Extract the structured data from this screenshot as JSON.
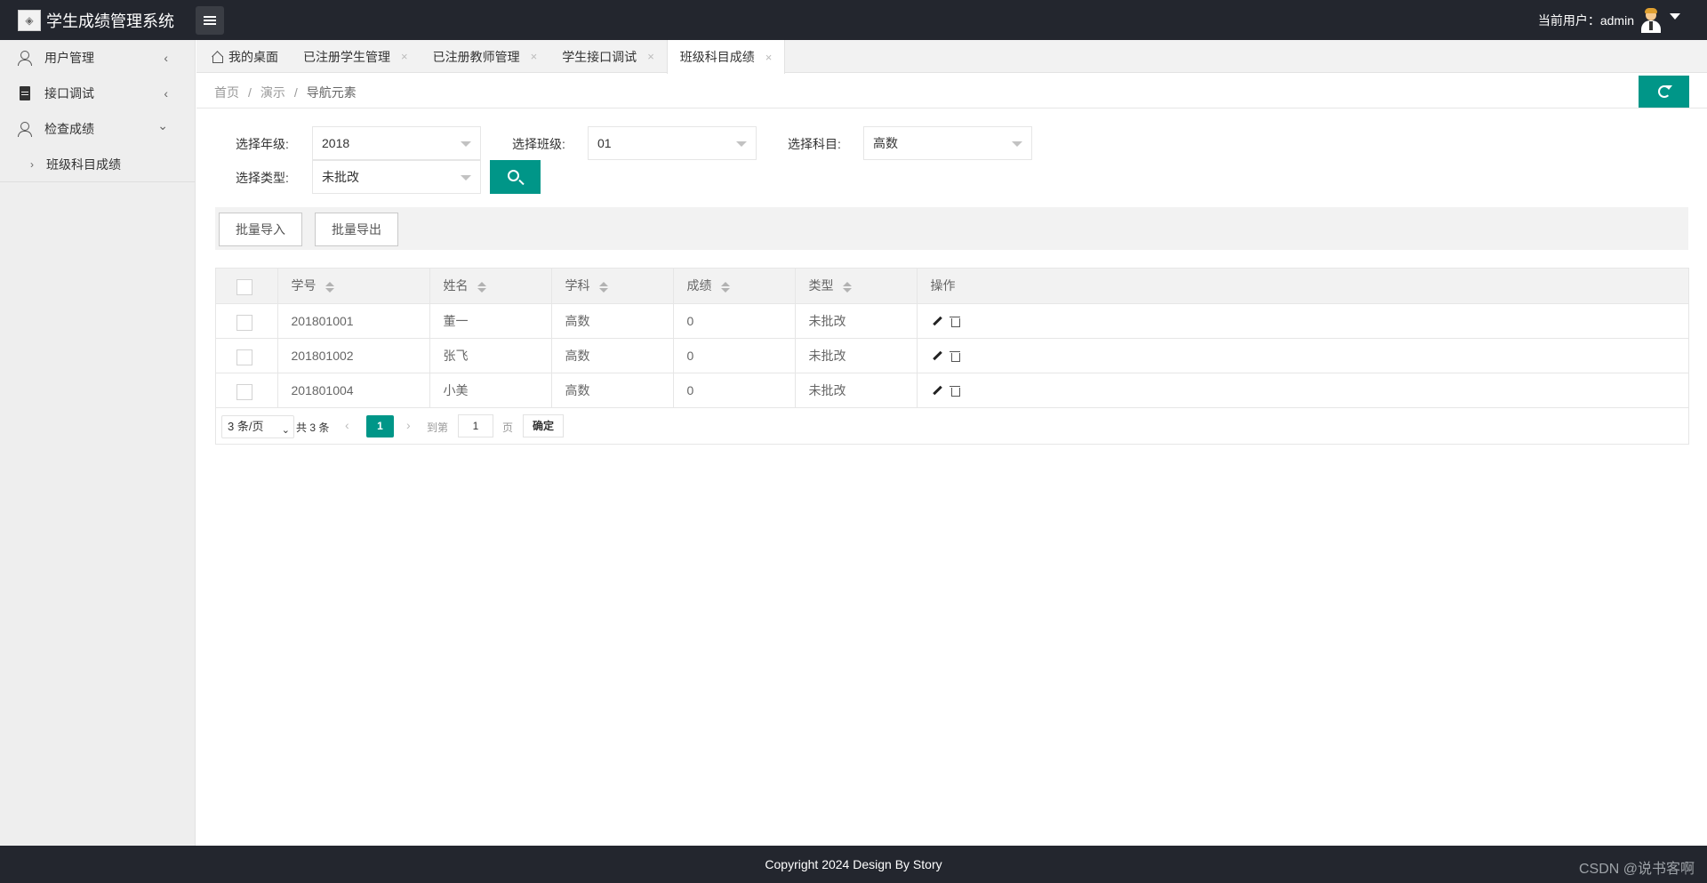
{
  "header": {
    "app_title": "学生成绩管理系统",
    "user_label": "当前用户：admin"
  },
  "sidebar": {
    "items": [
      {
        "label": "用户管理",
        "icon": "user-icon",
        "chevron": "‹"
      },
      {
        "label": "接口调试",
        "icon": "document-icon",
        "chevron": "‹"
      },
      {
        "label": "检查成绩",
        "icon": "user-icon",
        "chevron": "⌄"
      }
    ],
    "subitems": [
      {
        "label": "班级科目成绩",
        "arrow": "›"
      }
    ]
  },
  "tabs": [
    {
      "label": "我的桌面",
      "closable": false
    },
    {
      "label": "已注册学生管理",
      "closable": true,
      "close": "×"
    },
    {
      "label": "已注册教师管理",
      "closable": true,
      "close": "×"
    },
    {
      "label": "学生接口调试",
      "closable": true,
      "close": "×"
    },
    {
      "label": "班级科目成绩",
      "closable": true,
      "close": "×",
      "active": true
    }
  ],
  "breadcrumb": {
    "items": [
      "首页",
      "演示",
      "导航元素"
    ],
    "separator": "/"
  },
  "filters": {
    "grade_label": "选择年级:",
    "grade_value": "2018",
    "class_label": "选择班级:",
    "class_value": "01",
    "subject_label": "选择科目:",
    "subject_value": "高数",
    "type_label": "选择类型:",
    "type_value": "未批改"
  },
  "toolbar": {
    "import_label": "批量导入",
    "export_label": "批量导出"
  },
  "table": {
    "columns": [
      "学号",
      "姓名",
      "学科",
      "成绩",
      "类型",
      "操作"
    ],
    "rows": [
      {
        "id": "201801001",
        "name": "董一",
        "subject": "高数",
        "score": "0",
        "type": "未批改"
      },
      {
        "id": "201801002",
        "name": "张飞",
        "subject": "高数",
        "score": "0",
        "type": "未批改"
      },
      {
        "id": "201801004",
        "name": "小美",
        "subject": "高数",
        "score": "0",
        "type": "未批改"
      }
    ]
  },
  "pager": {
    "page_size": "3 条/页",
    "total": "共 3 条",
    "current_page": "1",
    "goto_label": "到第",
    "page_input": "1",
    "page_unit": "页",
    "confirm_label": "确定",
    "prev": "‹",
    "next": "›"
  },
  "footer": {
    "copyright": "Copyright 2024 Design By Story",
    "watermark": "CSDN @说书客啊"
  },
  "colors": {
    "accent": "#009688",
    "header_bg": "#23262e",
    "sidebar_bg": "#eeeeee"
  }
}
